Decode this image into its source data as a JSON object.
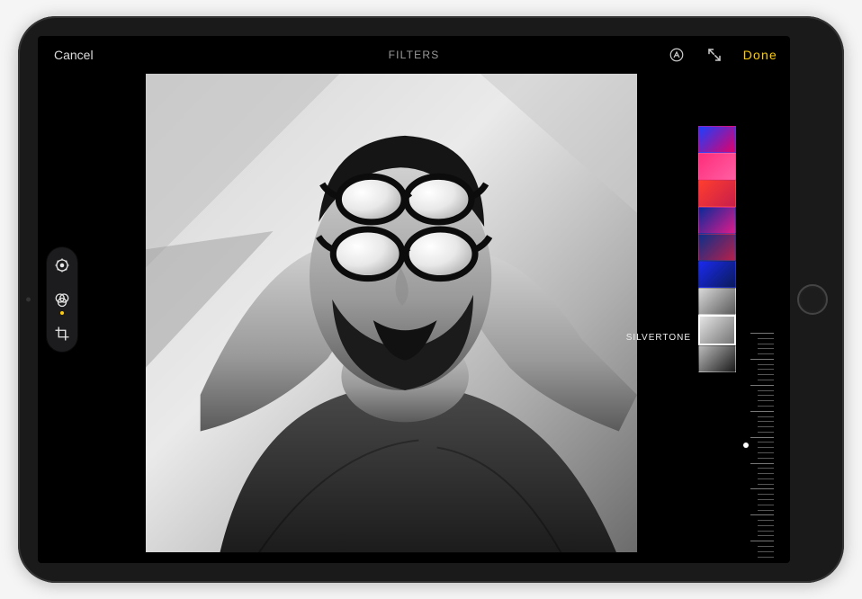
{
  "topbar": {
    "cancel_label": "Cancel",
    "title": "FILTERS",
    "done_label": "Done"
  },
  "left_tools": [
    {
      "name": "adjust",
      "active": false
    },
    {
      "name": "filters",
      "active": true
    },
    {
      "name": "crop",
      "active": false
    }
  ],
  "selected_filter": {
    "label": "SILVERTONE",
    "index": 7
  },
  "filters": [
    {
      "name": "original",
      "gradient": "linear-gradient(135deg,#1a3fff,#e2006a)"
    },
    {
      "name": "vivid",
      "gradient": "linear-gradient(135deg,#ff2d7a,#ff5ea3)"
    },
    {
      "name": "vivid-warm",
      "gradient": "linear-gradient(135deg,#ff3d2e,#c81e4a)"
    },
    {
      "name": "vivid-cool",
      "gradient": "linear-gradient(135deg,#0a2a9a,#e01a8a)"
    },
    {
      "name": "dramatic",
      "gradient": "linear-gradient(135deg,#0d2f8a,#b81f4a)"
    },
    {
      "name": "dramatic-cool",
      "gradient": "linear-gradient(135deg,#1a2aee,#0a1a5a)"
    },
    {
      "name": "mono",
      "gradient": "linear-gradient(135deg,#d8d8d8,#5a5a5a)"
    },
    {
      "name": "silvertone",
      "gradient": "linear-gradient(135deg,#e4e4e4,#747474)"
    },
    {
      "name": "noir",
      "gradient": "linear-gradient(135deg,#bababa,#1a1a1a)"
    }
  ],
  "colors": {
    "accent": "#ffcc00"
  }
}
